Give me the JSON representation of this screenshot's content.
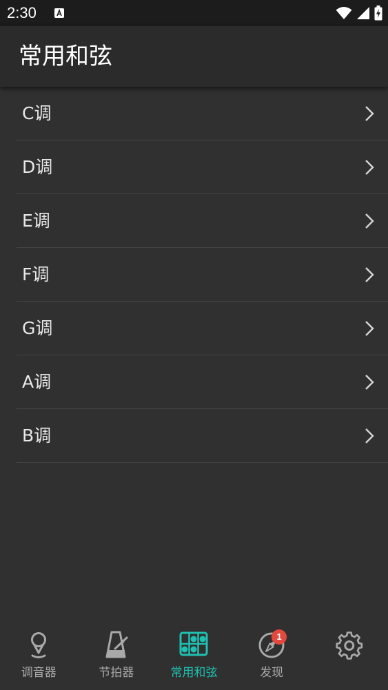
{
  "status_bar": {
    "time": "2:30",
    "notification_icon": "a-notification-icon",
    "wifi_icon": "wifi-icon",
    "signal_icon": "signal-icon",
    "battery_icon": "battery-charging-icon"
  },
  "app_bar": {
    "title": "常用和弦"
  },
  "keys": [
    {
      "label": "C调"
    },
    {
      "label": "D调"
    },
    {
      "label": "E调"
    },
    {
      "label": "F调"
    },
    {
      "label": "G调"
    },
    {
      "label": "A调"
    },
    {
      "label": "B调"
    }
  ],
  "bottom_nav": {
    "items": [
      {
        "label": "调音器",
        "icon": "tuner-icon",
        "active": false
      },
      {
        "label": "节拍器",
        "icon": "metronome-icon",
        "active": false
      },
      {
        "label": "常用和弦",
        "icon": "chord-icon",
        "active": true
      },
      {
        "label": "发现",
        "icon": "compass-icon",
        "active": false,
        "badge": "1"
      },
      {
        "label": "",
        "icon": "settings-icon",
        "active": false
      }
    ]
  },
  "colors": {
    "background": "#303030",
    "app_bar": "#2b2b2b",
    "accent": "#1fc0b1",
    "inactive": "#a9a9a9",
    "badge": "#e5483d"
  }
}
